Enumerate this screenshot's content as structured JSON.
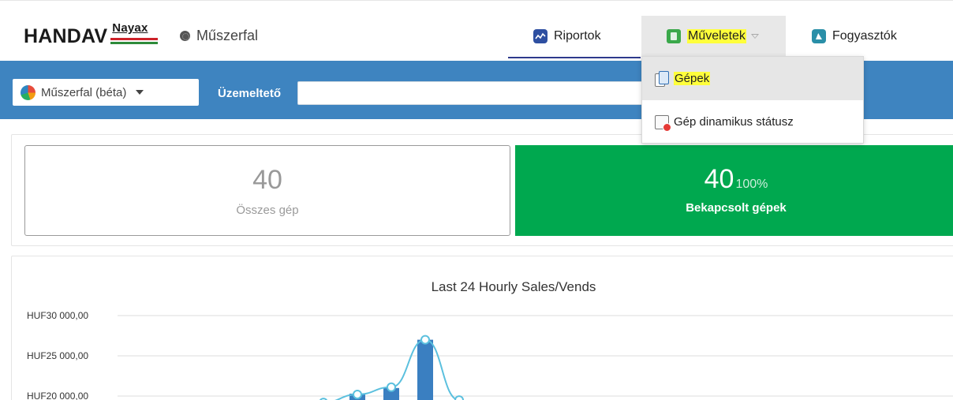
{
  "header": {
    "logo_handav": "HANDAV",
    "logo_nayax": "Nayax",
    "dashboard_label": "Műszerfal",
    "nav": [
      {
        "label": "Riportok",
        "icon": "chart-line-icon"
      },
      {
        "label": "Műveletek",
        "icon": "operations-icon",
        "highlighted": true
      },
      {
        "label": "Fogyasztók",
        "icon": "consumers-icon"
      }
    ]
  },
  "dropdown": {
    "items": [
      {
        "label": "Gépek",
        "icon": "machines-icon",
        "highlighted": true
      },
      {
        "label": "Gép dinamikus státusz",
        "icon": "machine-status-icon"
      }
    ]
  },
  "toolbar": {
    "dashboard_select": "Műszerfal (béta)",
    "operator_label": "Üzemeltető",
    "operator_value": ""
  },
  "stats": {
    "total": {
      "value": "40",
      "label": "Összes gép"
    },
    "online": {
      "value": "40",
      "percent": "100%",
      "label": "Bekapcsolt gépek"
    }
  },
  "colors": {
    "accent_blue": "#3e84c0",
    "online_green": "#00a84f",
    "highlight_yellow": "#ffff3b",
    "bar_blue": "#3a7fc1",
    "line_cyan": "#5bc0de"
  },
  "chart_data": {
    "type": "bar",
    "title": "Last 24 Hourly Sales/Vends",
    "yticks": [
      "HUF30 000,00",
      "HUF25 000,00",
      "HUF20 000,00"
    ],
    "ytick_values": [
      30000,
      25000,
      20000
    ],
    "series": [
      {
        "kind": "bar",
        "points": [
          {
            "x": 12,
            "y": 20300
          },
          {
            "x": 13,
            "y": 21000
          },
          {
            "x": 14,
            "y": 27000
          }
        ]
      },
      {
        "kind": "line",
        "points": [
          {
            "x": 11,
            "y": 19200
          },
          {
            "x": 12,
            "y": 20200
          },
          {
            "x": 13,
            "y": 21100
          },
          {
            "x": 14,
            "y": 27000
          },
          {
            "x": 15,
            "y": 19500
          }
        ]
      }
    ],
    "grid": true
  }
}
